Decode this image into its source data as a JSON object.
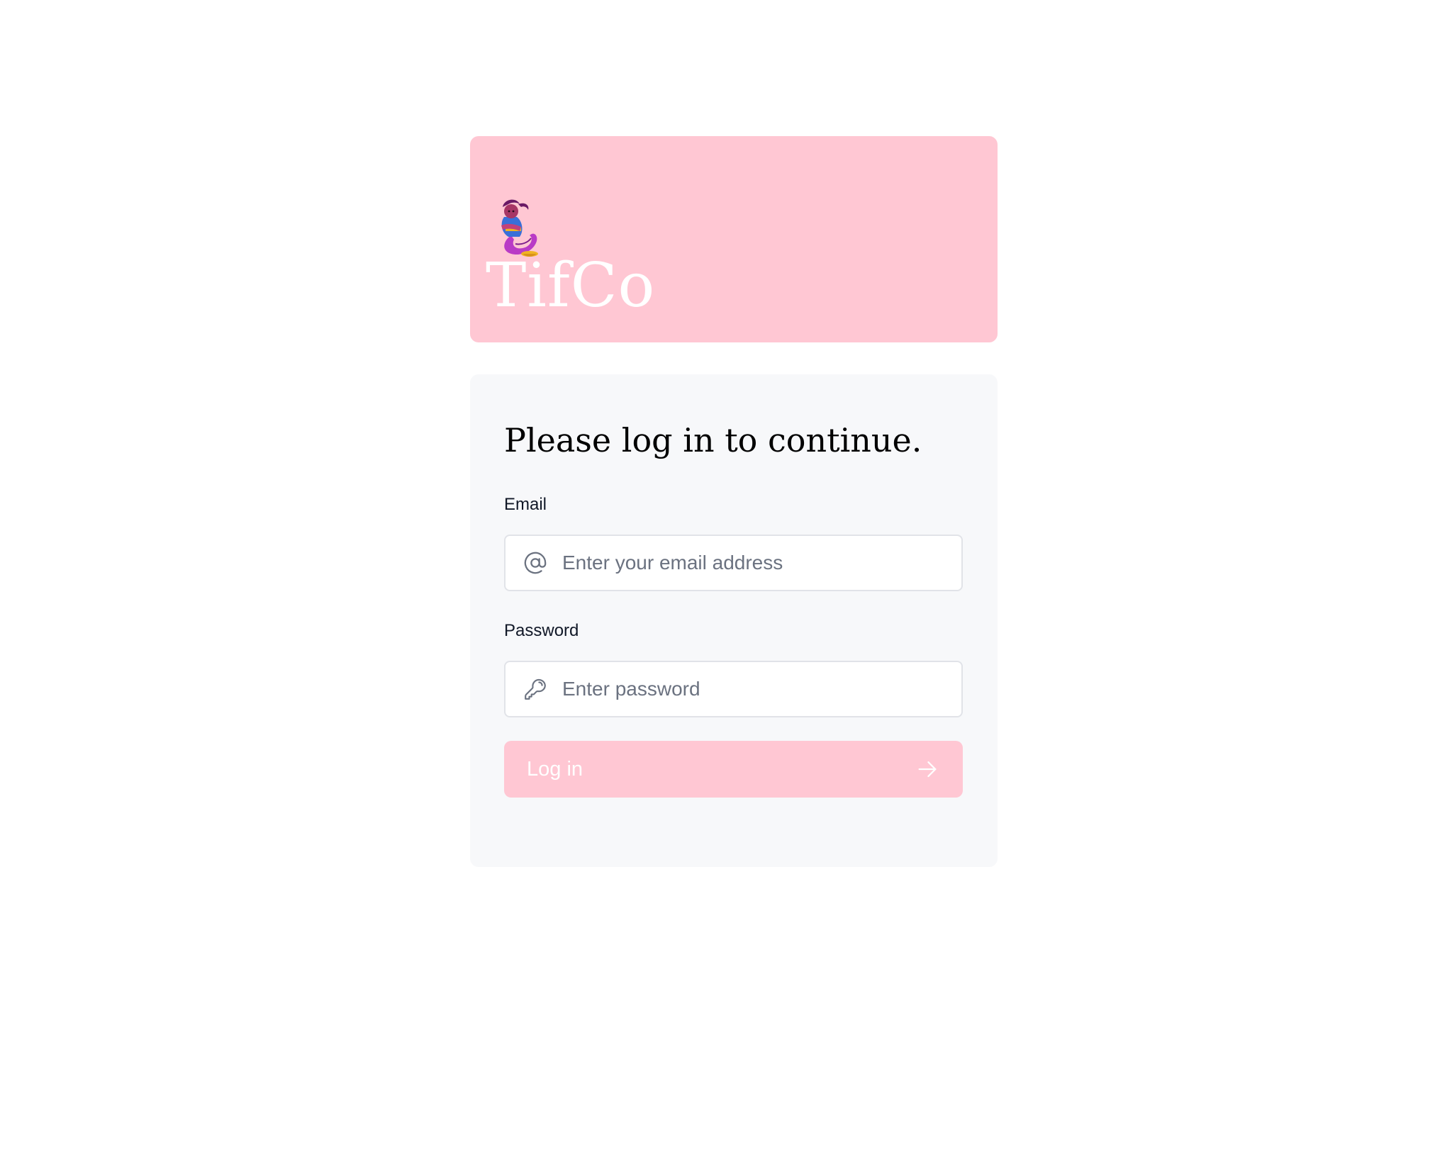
{
  "brand": {
    "name": "TifCo",
    "logo_icon": "genie-icon",
    "banner_color": "#ffc7d3"
  },
  "login": {
    "heading": "Please log in to continue.",
    "email": {
      "label": "Email",
      "placeholder": "Enter your email address",
      "value": "",
      "icon": "at-sign-icon"
    },
    "password": {
      "label": "Password",
      "placeholder": "Enter password",
      "value": "",
      "icon": "key-icon"
    },
    "submit": {
      "label": "Log in",
      "icon": "arrow-right-icon",
      "color": "#ffc7d3"
    }
  }
}
